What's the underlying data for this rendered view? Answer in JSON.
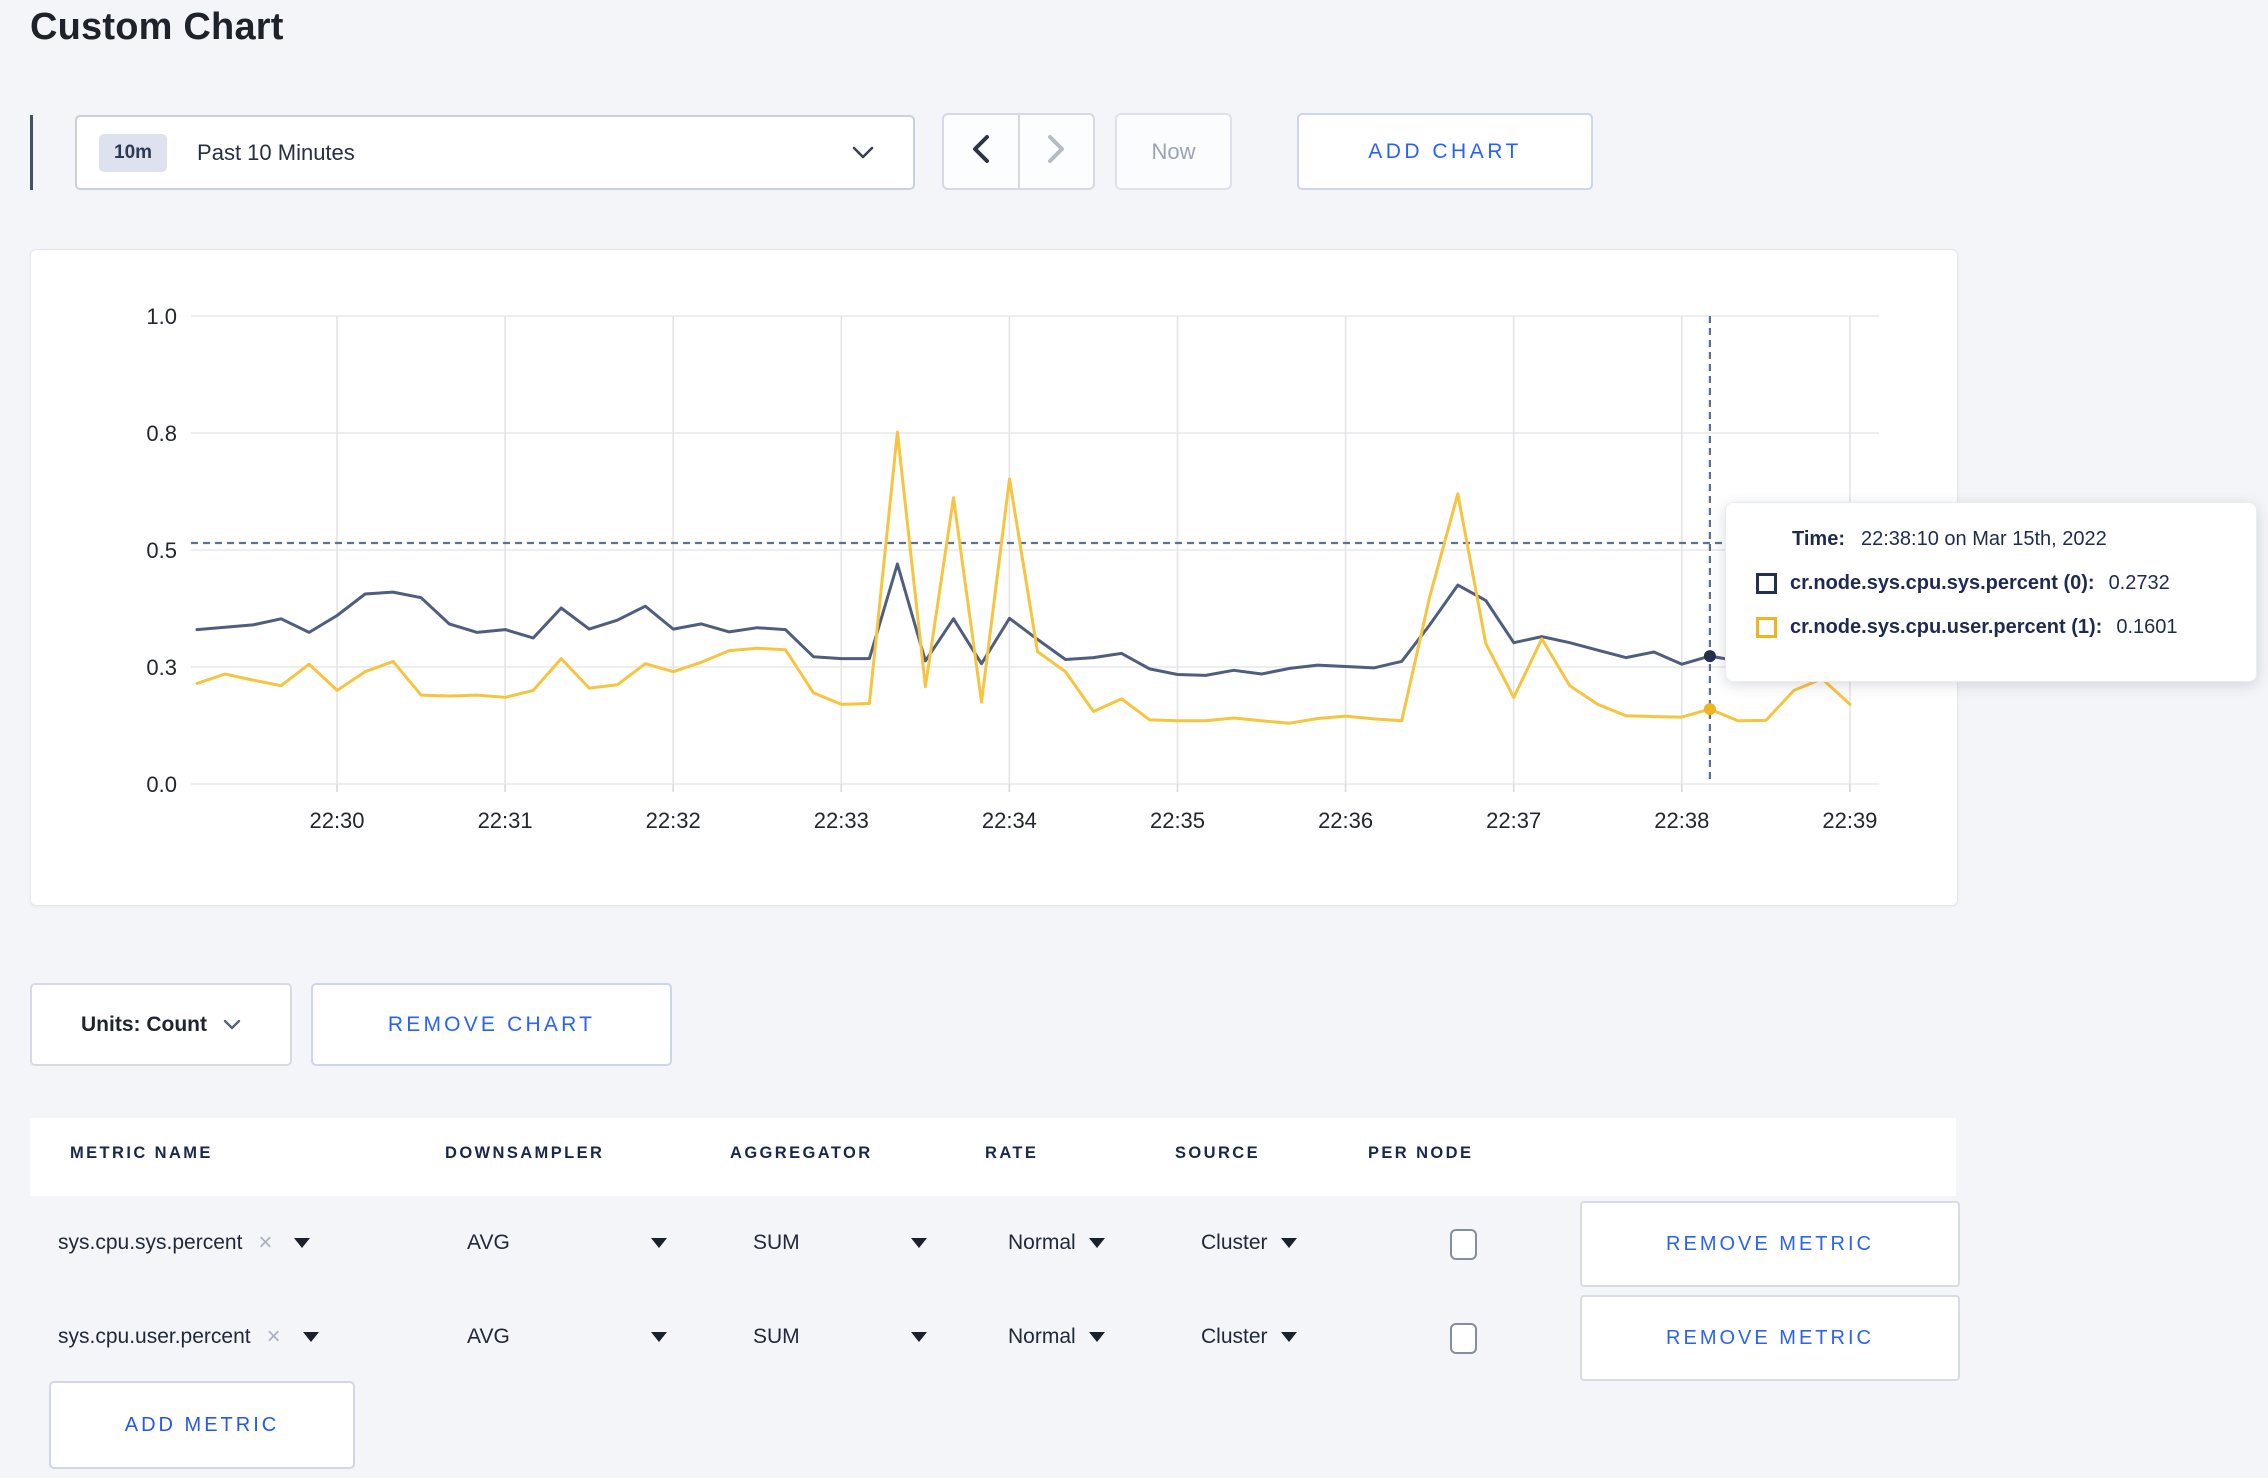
{
  "page": {
    "title": "Custom Chart"
  },
  "toolbar": {
    "timescale": {
      "badge": "10m",
      "label": "Past 10 Minutes"
    },
    "now_label": "Now",
    "add_chart_label": "ADD CHART"
  },
  "chart_data": {
    "type": "line",
    "title": "",
    "xlabel": "",
    "ylabel": "",
    "ylim": [
      0,
      1
    ],
    "yticks": [
      {
        "value": 0.0,
        "label": "0.0"
      },
      {
        "value": 0.25,
        "label": "0.3"
      },
      {
        "value": 0.5,
        "label": "0.5"
      },
      {
        "value": 0.75,
        "label": "0.8"
      },
      {
        "value": 1.0,
        "label": "1.0"
      }
    ],
    "xticks": [
      "22:30",
      "22:31",
      "22:32",
      "22:33",
      "22:34",
      "22:35",
      "22:36",
      "22:37",
      "22:38",
      "22:39"
    ],
    "x_start": "22:29:10",
    "x_end": "22:39:00",
    "x_interval_seconds": 10,
    "grid": true,
    "legend_position": "tooltip-only",
    "series": [
      {
        "name": "cr.node.sys.cpu.sys.percent (0)",
        "color": "#4f5e7e",
        "swatch_color": "#25304f",
        "values": [
          0.33,
          0.335,
          0.34,
          0.353,
          0.324,
          0.36,
          0.406,
          0.41,
          0.398,
          0.342,
          0.324,
          0.33,
          0.312,
          0.376,
          0.331,
          0.35,
          0.38,
          0.331,
          0.342,
          0.325,
          0.334,
          0.33,
          0.272,
          0.268,
          0.268,
          0.47,
          0.263,
          0.353,
          0.257,
          0.354,
          0.309,
          0.266,
          0.27,
          0.279,
          0.246,
          0.234,
          0.232,
          0.243,
          0.235,
          0.247,
          0.254,
          0.251,
          0.248,
          0.262,
          0.34,
          0.425,
          0.392,
          0.302,
          0.315,
          0.302,
          0.286,
          0.27,
          0.282,
          0.256,
          0.2732,
          0.263,
          0.27,
          0.272,
          0.268,
          0.27
        ]
      },
      {
        "name": "cr.node.sys.cpu.user.percent (1)",
        "color": "#f7c440",
        "swatch_color": "#f0b421",
        "values": [
          0.215,
          0.235,
          0.222,
          0.21,
          0.256,
          0.2,
          0.24,
          0.262,
          0.19,
          0.188,
          0.19,
          0.185,
          0.2,
          0.268,
          0.205,
          0.212,
          0.257,
          0.24,
          0.26,
          0.285,
          0.29,
          0.287,
          0.195,
          0.17,
          0.172,
          0.752,
          0.208,
          0.612,
          0.175,
          0.652,
          0.283,
          0.24,
          0.155,
          0.182,
          0.137,
          0.135,
          0.135,
          0.141,
          0.135,
          0.13,
          0.14,
          0.145,
          0.139,
          0.135,
          0.4,
          0.62,
          0.3,
          0.185,
          0.31,
          0.21,
          0.17,
          0.146,
          0.144,
          0.143,
          0.1601,
          0.135,
          0.136,
          0.2,
          0.225,
          0.17
        ]
      }
    ],
    "crosshair": {
      "time": "22:38:10",
      "point_index": 54,
      "hline_value": 0.515
    }
  },
  "tooltip": {
    "time_label": "Time:",
    "time_value": "22:38:10 on Mar 15th, 2022",
    "entries": [
      {
        "name": "cr.node.sys.cpu.sys.percent (0):",
        "value": "0.2732",
        "swatch_color": "#25304f"
      },
      {
        "name": "cr.node.sys.cpu.user.percent (1):",
        "value": "0.1601",
        "swatch_color": "#f0b421"
      }
    ]
  },
  "units_row": {
    "units_label": "Units: Count",
    "remove_chart_label": "REMOVE CHART"
  },
  "metrics_table": {
    "headers": [
      "METRIC NAME",
      "DOWNSAMPLER",
      "AGGREGATOR",
      "RATE",
      "SOURCE",
      "PER NODE"
    ],
    "rows": [
      {
        "metric": "sys.cpu.sys.percent",
        "downsampler": "AVG",
        "aggregator": "SUM",
        "rate": "Normal",
        "source": "Cluster",
        "per_node_checked": false,
        "remove_label": "REMOVE METRIC"
      },
      {
        "metric": "sys.cpu.user.percent",
        "downsampler": "AVG",
        "aggregator": "SUM",
        "rate": "Normal",
        "source": "Cluster",
        "per_node_checked": false,
        "remove_label": "REMOVE METRIC"
      }
    ],
    "add_metric_label": "ADD METRIC"
  },
  "colors": {
    "accent_blue": "#2962fb",
    "page_bg": "#f4f5f8",
    "grid_line": "#e7e8ec",
    "crosshair": "#5b7191",
    "axis_text": "#23262d"
  }
}
